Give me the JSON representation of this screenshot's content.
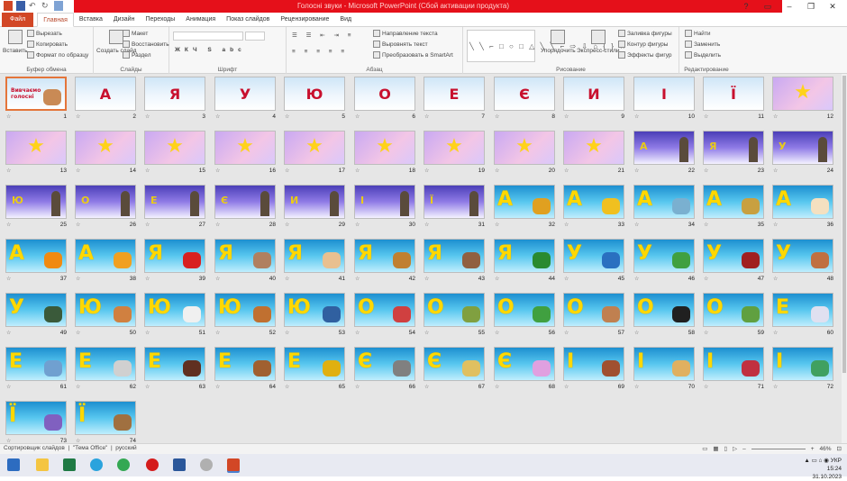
{
  "window": {
    "title": "Голосні звуки  -  Microsoft PowerPoint (Сбой активации продукта)",
    "buttons": [
      "?",
      "▭",
      "–",
      "❐",
      "✕"
    ]
  },
  "tabs": [
    {
      "label": "Файл"
    },
    {
      "label": "Главная"
    },
    {
      "label": "Вставка"
    },
    {
      "label": "Дизайн"
    },
    {
      "label": "Переходы"
    },
    {
      "label": "Анимация"
    },
    {
      "label": "Показ слайдов"
    },
    {
      "label": "Рецензирование"
    },
    {
      "label": "Вид"
    }
  ],
  "ribbon": {
    "clipboard": {
      "name": "Буфер обмена",
      "paste": "Вставить",
      "cut": "Вырезать",
      "copy": "Копировать",
      "format": "Формат по образцу"
    },
    "slides": {
      "name": "Слайды",
      "new": "Создать слайд",
      "layout": "Макет",
      "reset": "Восстановить",
      "section": "Раздел"
    },
    "font": {
      "name": "Шрифт"
    },
    "paragraph": {
      "name": "Абзац",
      "direction": "Направление текста",
      "align": "Выровнять текст",
      "smartart": "Преобразовать в SmartArt"
    },
    "drawing": {
      "name": "Рисование",
      "arrange": "Упорядочить",
      "styles": "Экспресс-стили",
      "fill": "Заливка фигуры",
      "outline": "Контур фигуры",
      "effects": "Эффекты фигур"
    },
    "editing": {
      "name": "Редактирование",
      "find": "Найти",
      "replace": "Заменить",
      "select": "Выделить"
    }
  },
  "slides": [
    {
      "n": "1",
      "bg": "cloud",
      "letter": "Вивчаємо голосні",
      "kind": "intro"
    },
    {
      "n": "2",
      "bg": "cloud",
      "letter": "А",
      "kind": "red"
    },
    {
      "n": "3",
      "bg": "cloud",
      "letter": "Я",
      "kind": "red"
    },
    {
      "n": "4",
      "bg": "cloud",
      "letter": "У",
      "kind": "red"
    },
    {
      "n": "5",
      "bg": "cloud",
      "letter": "Ю",
      "kind": "red"
    },
    {
      "n": "6",
      "bg": "cloud",
      "letter": "О",
      "kind": "red"
    },
    {
      "n": "7",
      "bg": "cloud",
      "letter": "Е",
      "kind": "red"
    },
    {
      "n": "8",
      "bg": "cloud",
      "letter": "Є",
      "kind": "red"
    },
    {
      "n": "9",
      "bg": "cloud",
      "letter": "И",
      "kind": "red"
    },
    {
      "n": "10",
      "bg": "cloud",
      "letter": "І",
      "kind": "red"
    },
    {
      "n": "11",
      "bg": "cloud",
      "letter": "Ї",
      "kind": "red"
    },
    {
      "n": "12",
      "bg": "purple",
      "letter": "★",
      "kind": "star"
    },
    {
      "n": "13",
      "bg": "purple",
      "letter": "★",
      "kind": "star"
    },
    {
      "n": "14",
      "bg": "purple",
      "letter": "★",
      "kind": "star"
    },
    {
      "n": "15",
      "bg": "purple",
      "letter": "★",
      "kind": "star"
    },
    {
      "n": "16",
      "bg": "purple",
      "letter": "★",
      "kind": "star"
    },
    {
      "n": "17",
      "bg": "purple",
      "letter": "★",
      "kind": "star"
    },
    {
      "n": "18",
      "bg": "purple",
      "letter": "★",
      "kind": "star"
    },
    {
      "n": "19",
      "bg": "purple",
      "letter": "★",
      "kind": "star"
    },
    {
      "n": "20",
      "bg": "purple",
      "letter": "★",
      "kind": "star"
    },
    {
      "n": "21",
      "bg": "purple",
      "letter": "★",
      "kind": "star"
    },
    {
      "n": "22",
      "bg": "night",
      "letter": "А",
      "kind": "night"
    },
    {
      "n": "23",
      "bg": "night",
      "letter": "Я",
      "kind": "night"
    },
    {
      "n": "24",
      "bg": "night",
      "letter": "У",
      "kind": "night"
    },
    {
      "n": "25",
      "bg": "night",
      "letter": "Ю",
      "kind": "night"
    },
    {
      "n": "26",
      "bg": "night",
      "letter": "О",
      "kind": "night"
    },
    {
      "n": "27",
      "bg": "night",
      "letter": "Е",
      "kind": "night"
    },
    {
      "n": "28",
      "bg": "night",
      "letter": "Є",
      "kind": "night"
    },
    {
      "n": "29",
      "bg": "night",
      "letter": "И",
      "kind": "night"
    },
    {
      "n": "30",
      "bg": "night",
      "letter": "І",
      "kind": "night"
    },
    {
      "n": "31",
      "bg": "night",
      "letter": "Ї",
      "kind": "night"
    },
    {
      "n": "32",
      "bg": "ocean",
      "letter": "А",
      "kind": "yel",
      "pic": "#e0a020"
    },
    {
      "n": "33",
      "bg": "ocean",
      "letter": "А",
      "kind": "yel",
      "pic": "#f0c020"
    },
    {
      "n": "34",
      "bg": "ocean",
      "letter": "А",
      "kind": "yel",
      "pic": "#7ab0d0"
    },
    {
      "n": "35",
      "bg": "ocean",
      "letter": "А",
      "kind": "yel",
      "pic": "#c8a040"
    },
    {
      "n": "36",
      "bg": "ocean",
      "letter": "А",
      "kind": "yel",
      "pic": "#f4e0c0"
    },
    {
      "n": "37",
      "bg": "ocean",
      "letter": "А",
      "kind": "yel",
      "pic": "#f08a10"
    },
    {
      "n": "38",
      "bg": "ocean",
      "letter": "А",
      "kind": "yel",
      "pic": "#f0a020"
    },
    {
      "n": "39",
      "bg": "ocean",
      "letter": "Я",
      "kind": "yel",
      "pic": "#d82020"
    },
    {
      "n": "40",
      "bg": "ocean",
      "letter": "Я",
      "kind": "yel",
      "pic": "#b08060"
    },
    {
      "n": "41",
      "bg": "ocean",
      "letter": "Я",
      "kind": "yel",
      "pic": "#e8c090"
    },
    {
      "n": "42",
      "bg": "ocean",
      "letter": "Я",
      "kind": "yel",
      "pic": "#c08030"
    },
    {
      "n": "43",
      "bg": "ocean",
      "letter": "Я",
      "kind": "yel",
      "pic": "#906040"
    },
    {
      "n": "44",
      "bg": "ocean",
      "letter": "Я",
      "kind": "yel",
      "pic": "#2a8a30"
    },
    {
      "n": "45",
      "bg": "ocean",
      "letter": "У",
      "kind": "yel",
      "pic": "#2a70c0"
    },
    {
      "n": "46",
      "bg": "ocean",
      "letter": "У",
      "kind": "yel",
      "pic": "#40a040"
    },
    {
      "n": "47",
      "bg": "ocean",
      "letter": "У",
      "kind": "yel",
      "pic": "#a02020"
    },
    {
      "n": "48",
      "bg": "ocean",
      "letter": "У",
      "kind": "yel",
      "pic": "#c07040"
    },
    {
      "n": "49",
      "bg": "ocean",
      "letter": "У",
      "kind": "yel",
      "pic": "#3a5a3a"
    },
    {
      "n": "50",
      "bg": "ocean",
      "letter": "Ю",
      "kind": "yel",
      "pic": "#d08040"
    },
    {
      "n": "51",
      "bg": "ocean",
      "letter": "Ю",
      "kind": "yel",
      "pic": "#f0f0f0"
    },
    {
      "n": "52",
      "bg": "ocean",
      "letter": "Ю",
      "kind": "yel",
      "pic": "#c07030"
    },
    {
      "n": "53",
      "bg": "ocean",
      "letter": "Ю",
      "kind": "yel",
      "pic": "#3060a0"
    },
    {
      "n": "54",
      "bg": "ocean",
      "letter": "О",
      "kind": "yel",
      "pic": "#d04040"
    },
    {
      "n": "55",
      "bg": "ocean",
      "letter": "О",
      "kind": "yel",
      "pic": "#80a040"
    },
    {
      "n": "56",
      "bg": "ocean",
      "letter": "О",
      "kind": "yel",
      "pic": "#40a040"
    },
    {
      "n": "57",
      "bg": "ocean",
      "letter": "О",
      "kind": "yel",
      "pic": "#c08050"
    },
    {
      "n": "58",
      "bg": "ocean",
      "letter": "О",
      "kind": "yel",
      "pic": "#202020"
    },
    {
      "n": "59",
      "bg": "ocean",
      "letter": "О",
      "kind": "yel",
      "pic": "#60a040"
    },
    {
      "n": "60",
      "bg": "ocean",
      "letter": "Е",
      "kind": "yel",
      "pic": "#e0e0f0"
    },
    {
      "n": "61",
      "bg": "ocean",
      "letter": "Е",
      "kind": "yel",
      "pic": "#70a0d0"
    },
    {
      "n": "62",
      "bg": "ocean",
      "letter": "Е",
      "kind": "yel",
      "pic": "#d0d0d0"
    },
    {
      "n": "63",
      "bg": "ocean",
      "letter": "Е",
      "kind": "yel",
      "pic": "#603020"
    },
    {
      "n": "64",
      "bg": "ocean",
      "letter": "Е",
      "kind": "yel",
      "pic": "#a06030"
    },
    {
      "n": "65",
      "bg": "ocean",
      "letter": "Е",
      "kind": "yel",
      "pic": "#e0b010"
    },
    {
      "n": "66",
      "bg": "ocean",
      "letter": "Є",
      "kind": "yel",
      "pic": "#808080"
    },
    {
      "n": "67",
      "bg": "ocean",
      "letter": "Є",
      "kind": "yel",
      "pic": "#e0c060"
    },
    {
      "n": "68",
      "bg": "ocean",
      "letter": "Є",
      "kind": "yel",
      "pic": "#e0a0e0"
    },
    {
      "n": "69",
      "bg": "ocean",
      "letter": "І",
      "kind": "yel",
      "pic": "#a05030"
    },
    {
      "n": "70",
      "bg": "ocean",
      "letter": "І",
      "kind": "yel",
      "pic": "#e0b060"
    },
    {
      "n": "71",
      "bg": "ocean",
      "letter": "І",
      "kind": "yel",
      "pic": "#c03040"
    },
    {
      "n": "72",
      "bg": "ocean",
      "letter": "І",
      "kind": "yel",
      "pic": "#40a060"
    },
    {
      "n": "73",
      "bg": "ocean",
      "letter": "Ї",
      "kind": "yel",
      "pic": "#8060c0"
    },
    {
      "n": "74",
      "bg": "ocean",
      "letter": "Ї",
      "kind": "yel",
      "pic": "#a07040"
    }
  ],
  "statusbar": {
    "view": "Сортировщик слайдов",
    "theme": "\"Тема Office\"",
    "lang": "русский",
    "zoom": "46%"
  },
  "taskbar": {
    "lang": "УКР",
    "time": "15:24",
    "date": "31.10.2023"
  }
}
